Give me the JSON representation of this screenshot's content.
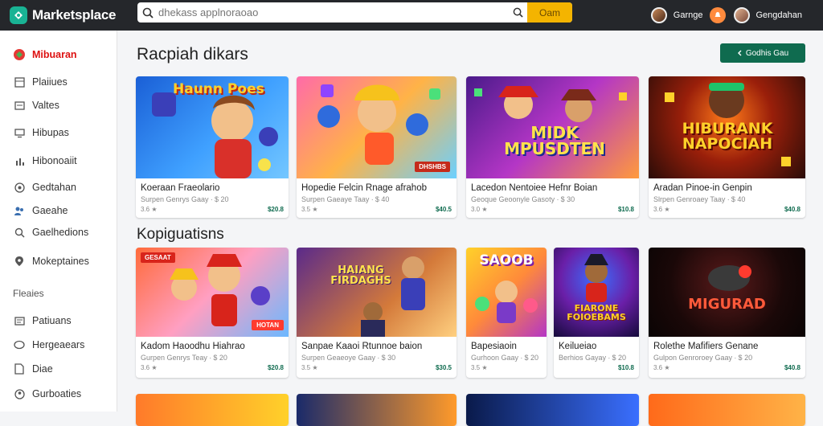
{
  "header": {
    "app_name": "Marketsplace",
    "search_placeholder": "dhekass applnoraoao",
    "search_button": "Oam",
    "user1_name": "Garnge",
    "user2_name": "Gengdahan"
  },
  "sidebar": {
    "items": [
      {
        "label": "Mibuaran",
        "icon": "game-icon",
        "active": true
      },
      {
        "label": "Plaiiues",
        "icon": "grid-icon"
      },
      {
        "label": "Valtes",
        "icon": "wallet-icon"
      },
      {
        "label": "Hibupas",
        "icon": "monitor-icon"
      },
      {
        "label": "Hibonoaiit",
        "icon": "bars-icon"
      },
      {
        "label": "Gedtahan",
        "icon": "target-icon"
      },
      {
        "label": "Gaeahe",
        "icon": "people-icon"
      },
      {
        "label": "Gaelhedions",
        "icon": "search-icon"
      },
      {
        "label": "Mokeptaines",
        "icon": "location-icon"
      }
    ],
    "section_label": "Fleaies",
    "section_items": [
      {
        "label": "Patiuans",
        "icon": "tag-icon"
      },
      {
        "label": "Hergeaears",
        "icon": "chat-icon"
      },
      {
        "label": "Diae",
        "icon": "file-icon"
      },
      {
        "label": "Gurboaties",
        "icon": "user-icon"
      }
    ]
  },
  "section1": {
    "title": "Racpiah dikars",
    "cta_label": "Godhis Gau",
    "cards": [
      {
        "art": "Haunn Poes",
        "title": "Koeraan Fraeolario",
        "sub": "Surpen Genrys Gaay ∙ $ 20",
        "meta": "3.6 ★",
        "price": "$20.8"
      },
      {
        "art": "",
        "badge": "DHSHBS",
        "title": "Hopedie Felcin Rnage afrahob",
        "sub": "Surpen Gaeaye Taay ∙ $ 40",
        "meta": "3.5 ★",
        "price": "$40.5"
      },
      {
        "art": "MIDK MPUSDTEN",
        "title": "Lacedon Nentoiee Hefnr Boian",
        "sub": "Geoque Geoonyle Gasoty ∙ $ 30",
        "meta": "3.0 ★",
        "price": "$10.8"
      },
      {
        "art": "HIBURANK NAPOCIAH",
        "title": "Aradan Pinoe-in Genpin",
        "sub": "Slrpen Genroaey Taay ∙ $ 40",
        "meta": "3.6 ★",
        "price": "$40.8"
      }
    ]
  },
  "section2": {
    "title": "Kopiguatisns",
    "cards": [
      {
        "art": "",
        "badge": "GESAAT",
        "tag": "HOTAN",
        "title": "Kadom Haoodhu Hiahrao",
        "sub": "Gurpen Genrys Teay ∙ $ 20",
        "meta": "3.6 ★",
        "price": "$20.8"
      },
      {
        "art": "HAIANG FIRDAGHS",
        "title": "Sanpae Kaaoi Rtunnoe baion",
        "sub": "Surpen Geaeoye Gaay ∙ $ 30",
        "meta": "3.5 ★",
        "price": "$30.5"
      },
      {
        "art": "SAOOB",
        "title": "Bapesiaoin",
        "sub": "Gurhoon Gaay ∙ $ 20",
        "meta": "3.5 ★",
        "price": ""
      },
      {
        "art": "FIARONE FOIOEBAMS",
        "title": "Keilueiao",
        "sub": "Berhios Gayay ∙ $ 20",
        "meta": "",
        "price": "$10.8"
      },
      {
        "art": "MIGURAD",
        "title": "Rolethe Mafifiers Genane",
        "sub": "Gulpon Genroroey Gaay ∙ $ 20",
        "meta": "3.6 ★",
        "price": "$40.8"
      }
    ]
  }
}
